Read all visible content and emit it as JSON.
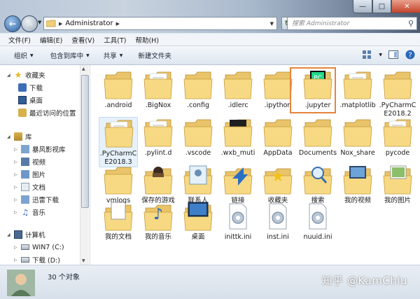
{
  "address": {
    "crumb": "Administrator",
    "search_placeholder": "搜索 Administrator"
  },
  "menu": [
    "文件(F)",
    "编辑(E)",
    "查看(V)",
    "工具(T)",
    "帮助(H)"
  ],
  "toolbar": {
    "organize": "组织",
    "include": "包含到库中",
    "share": "共享",
    "new_folder": "新建文件夹"
  },
  "sidebar": {
    "favorites": "收藏夹",
    "downloads": "下载",
    "desktop": "桌面",
    "recent": "最近访问的位置",
    "libraries": "库",
    "storm": "暴风影视库",
    "videos": "视频",
    "pictures": "图片",
    "documents": "文档",
    "xunlei": "迅雷下载",
    "music": "音乐",
    "computer": "计算机",
    "win7": "WIN7 (C:)",
    "dl_drive": "下载 (D:)"
  },
  "items": [
    {
      "label": ".android",
      "icon": "folder-icon"
    },
    {
      "label": ".BigNox",
      "icon": "folder-doc-icon"
    },
    {
      "label": ".config",
      "icon": "folder-icon"
    },
    {
      "label": ".idlerc",
      "icon": "folder-icon"
    },
    {
      "label": ".ipython",
      "icon": "folder-icon"
    },
    {
      "label": ".jupyter",
      "icon": "pycharm-folder-icon"
    },
    {
      "label": ".matplotlib",
      "icon": "folder-doc-icon"
    },
    {
      "label": ".PyCharmCE2018.2",
      "icon": "folder-icon"
    },
    {
      "label": ".PyCharmCE2018.3",
      "icon": "folder-doc-icon"
    },
    {
      "label": ".pylint.d",
      "icon": "folder-doc-icon"
    },
    {
      "label": ".vscode",
      "icon": "folder-icon"
    },
    {
      "label": ".wxb_muti",
      "icon": "folder-dark-icon"
    },
    {
      "label": "AppData",
      "icon": "folder-icon"
    },
    {
      "label": "Documents",
      "icon": "folder-icon"
    },
    {
      "label": "Nox_share",
      "icon": "folder-icon"
    },
    {
      "label": "pycode",
      "icon": "folder-doc-icon"
    },
    {
      "label": "vmlogs",
      "icon": "folder-icon"
    },
    {
      "label": "保存的游戏",
      "icon": "games-folder-icon"
    },
    {
      "label": "联系人",
      "icon": "contacts-folder-icon"
    },
    {
      "label": "链接",
      "icon": "links-folder-icon"
    },
    {
      "label": "收藏夹",
      "icon": "favorites-folder-icon"
    },
    {
      "label": "搜索",
      "icon": "search-folder-icon"
    },
    {
      "label": "我的视频",
      "icon": "videos-folder-icon"
    },
    {
      "label": "我的图片",
      "icon": "pictures-folder-icon"
    },
    {
      "label": "我的文档",
      "icon": "documents-folder-icon"
    },
    {
      "label": "我的音乐",
      "icon": "music-folder-icon"
    },
    {
      "label": "桌面",
      "icon": "desktop-folder-icon"
    },
    {
      "label": "inittk.ini",
      "icon": "ini-file-icon"
    },
    {
      "label": "inst.ini",
      "icon": "ini-file-icon"
    },
    {
      "label": "nuuid.ini",
      "icon": "ini-file-icon"
    }
  ],
  "status": {
    "count": "30 个对象"
  },
  "watermark": "知乎 @KamChiu",
  "colors": {
    "folder": "#f3d27a",
    "highlight": "#e5853c",
    "selection": "#e6f1fb"
  }
}
